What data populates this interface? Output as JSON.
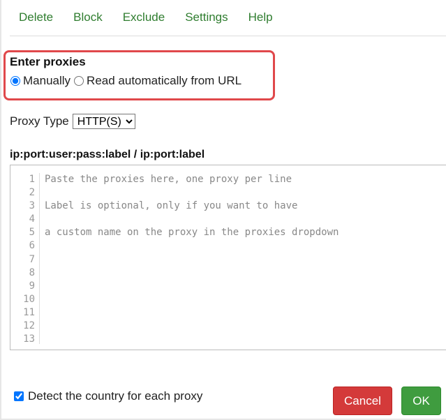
{
  "menu": {
    "items": [
      "Delete",
      "Block",
      "Exclude",
      "Settings",
      "Help"
    ]
  },
  "enter": {
    "title": "Enter proxies",
    "manual_label": "Manually",
    "url_label": "Read automatically from URL",
    "selected": "Manually",
    "highlight_color": "#e0484b"
  },
  "proxy_type": {
    "label": "Proxy Type",
    "value": "HTTP(S)"
  },
  "format_label": "ip:port:user:pass:label / ip:port:label",
  "editor": {
    "line_numbers": [
      "1",
      "2",
      "3",
      "4",
      "5",
      "6",
      "7",
      "8",
      "9",
      "10",
      "11",
      "12",
      "13"
    ],
    "lines": [
      "Paste the proxies here, one proxy per line",
      "",
      "Label is optional, only if you want to have",
      "",
      "a custom name on the proxy in the proxies dropdown",
      "",
      "",
      "",
      "",
      "",
      "",
      "",
      ""
    ]
  },
  "detect": {
    "label": "Detect the country for each proxy",
    "checked": true
  },
  "buttons": {
    "cancel": "Cancel",
    "ok": "OK",
    "cancel_color": "#d43a3a",
    "ok_color": "#3f9c3f"
  }
}
